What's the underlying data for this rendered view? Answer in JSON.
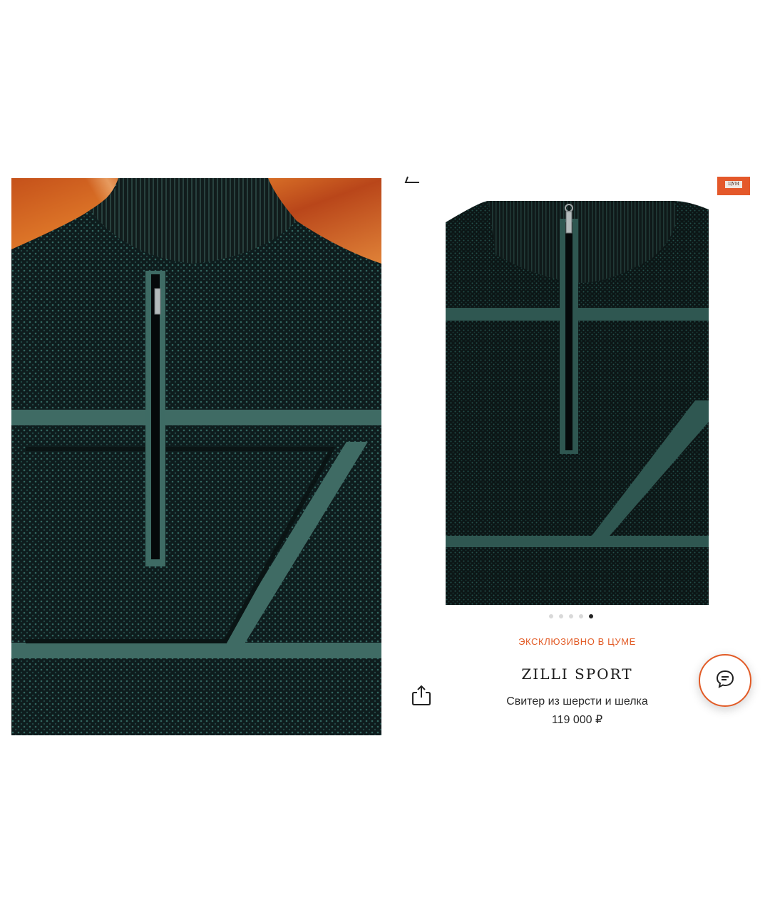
{
  "product": {
    "exclusive_label": "ЭКСКЛЮЗИВНО В ЦУМЕ",
    "brand": "ZILLI SPORT",
    "name": "Свитер из шерсти и шелка",
    "price": "119 000 ₽"
  },
  "gallery": {
    "dot_count": 5,
    "active_index": 4
  },
  "icons": {
    "back": "back-arrow-icon",
    "logo": "tsum-logo-badge",
    "share": "share-icon",
    "chat": "chat-bubble-icon"
  },
  "colors": {
    "accent": "#e25b26",
    "sweater_dark": "#0e1c1d",
    "sweater_stripe": "#3f6b64"
  },
  "logo_text": "ЦУМ"
}
